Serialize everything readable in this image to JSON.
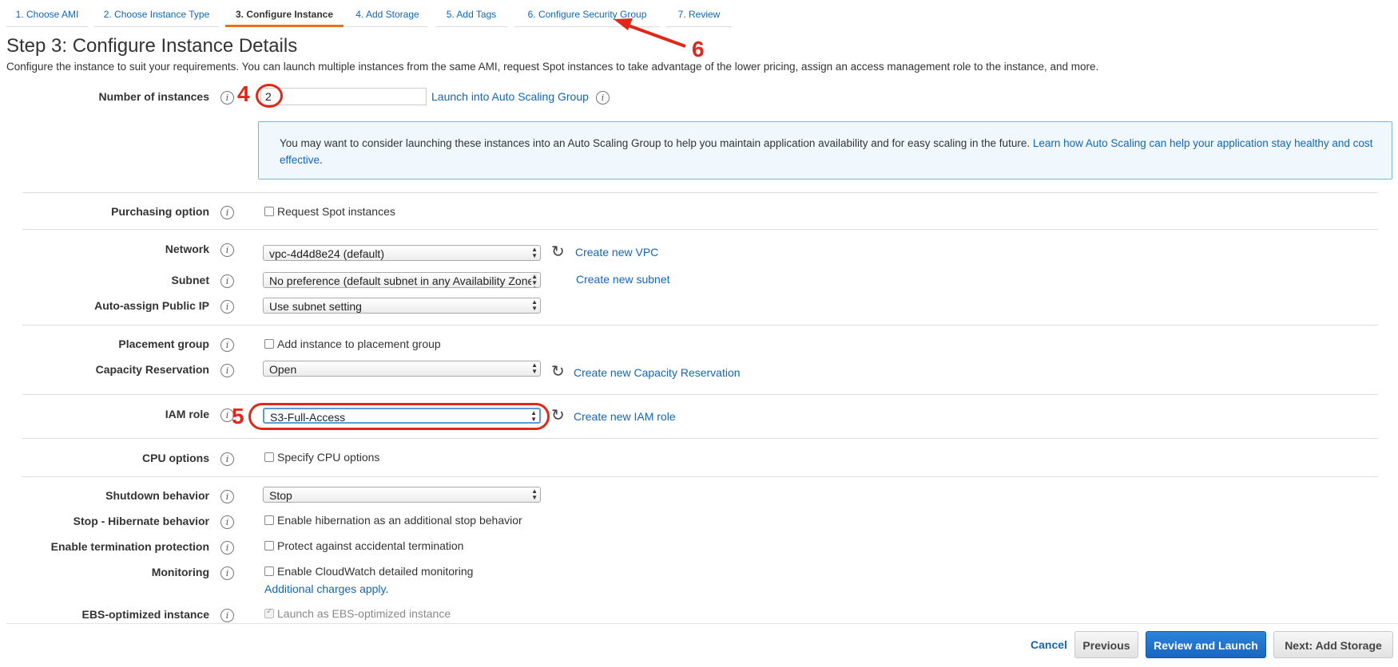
{
  "tabs": [
    {
      "label": "1. Choose AMI",
      "active": false
    },
    {
      "label": "2. Choose Instance Type",
      "active": false
    },
    {
      "label": "3. Configure Instance",
      "active": true
    },
    {
      "label": "4. Add Storage",
      "active": false
    },
    {
      "label": "5. Add Tags",
      "active": false
    },
    {
      "label": "6. Configure Security Group",
      "active": false
    },
    {
      "label": "7. Review",
      "active": false
    }
  ],
  "page": {
    "title": "Step 3: Configure Instance Details",
    "description": "Configure the instance to suit your requirements. You can launch multiple instances from the same AMI, request Spot instances to take advantage of the lower pricing, assign an access management role to the instance, and more."
  },
  "instances": {
    "label": "Number of instances",
    "value": "2",
    "asg_link": "Launch into Auto Scaling Group"
  },
  "notice": {
    "text": "You may want to consider launching these instances into an Auto Scaling Group to help you maintain application availability and for easy scaling in the future.",
    "link": "Learn how Auto Scaling can help your application stay healthy and cost effective",
    "period": "."
  },
  "purchasing": {
    "label": "Purchasing option",
    "checkbox": "Request Spot instances"
  },
  "network": {
    "label": "Network",
    "value": "vpc-4d4d8e24 (default)",
    "link": "Create new VPC"
  },
  "subnet": {
    "label": "Subnet",
    "value": "No preference (default subnet in any Availability Zone)",
    "link": "Create new subnet"
  },
  "public_ip": {
    "label": "Auto-assign Public IP",
    "value": "Use subnet setting"
  },
  "placement": {
    "label": "Placement group",
    "checkbox": "Add instance to placement group"
  },
  "capacity": {
    "label": "Capacity Reservation",
    "value": "Open",
    "link": "Create new Capacity Reservation"
  },
  "iam": {
    "label": "IAM role",
    "value": "S3-Full-Access",
    "link": "Create new IAM role"
  },
  "cpu": {
    "label": "CPU options",
    "checkbox": "Specify CPU options"
  },
  "shutdown": {
    "label": "Shutdown behavior",
    "value": "Stop"
  },
  "hibernate": {
    "label": "Stop - Hibernate behavior",
    "checkbox": "Enable hibernation as an additional stop behavior"
  },
  "termination": {
    "label": "Enable termination protection",
    "checkbox": "Protect against accidental termination"
  },
  "monitoring": {
    "label": "Monitoring",
    "checkbox": "Enable CloudWatch detailed monitoring",
    "charges_link": "Additional charges apply",
    "period": "."
  },
  "ebs": {
    "label": "EBS-optimized instance",
    "checkbox": "Launch as EBS-optimized instance"
  },
  "annotations": {
    "four": "4",
    "five": "5",
    "six": "6"
  },
  "footer": {
    "cancel": "Cancel",
    "previous": "Previous",
    "review": "Review and Launch",
    "next": "Next: Add Storage"
  },
  "colors": {
    "accent": "#ec7211",
    "link": "#1166bb",
    "primary_button": "#1a66c2",
    "annotation": "#e0281a"
  }
}
